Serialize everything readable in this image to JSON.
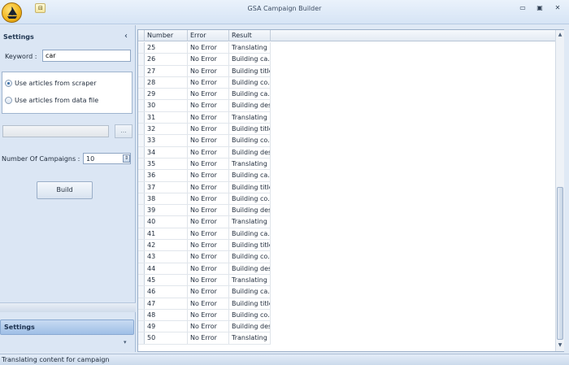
{
  "window": {
    "title": "GSA Campaign Builder",
    "qat_glyph": "⊟",
    "minimize_glyph": "▭",
    "maximize_glyph": "▣",
    "close_glyph": "✕"
  },
  "settings": {
    "title": "Settings",
    "collapse_glyph": "‹",
    "keyword_label": "Keyword :",
    "keyword_value": "car",
    "radio_scraper_label": "Use articles from scraper",
    "radio_file_label": "Use articles from data file",
    "selected_source": "scraper",
    "browse_label": "...",
    "campaigns_label": "Number Of Campaigns :",
    "campaigns_value": "10",
    "build_label": "Build",
    "tab_label": "Settings",
    "chevron_glyph": "▾"
  },
  "grid": {
    "columns": [
      "Number",
      "Error",
      "Result"
    ],
    "rows": [
      [
        "25",
        "No Error",
        "Translating ..."
      ],
      [
        "26",
        "No Error",
        "Building ca..."
      ],
      [
        "27",
        "No Error",
        "Building title..."
      ],
      [
        "28",
        "No Error",
        "Building co..."
      ],
      [
        "29",
        "No Error",
        "Building ca..."
      ],
      [
        "30",
        "No Error",
        "Building des..."
      ],
      [
        "31",
        "No Error",
        "Translating ..."
      ],
      [
        "32",
        "No Error",
        "Building title..."
      ],
      [
        "33",
        "No Error",
        "Building co..."
      ],
      [
        "34",
        "No Error",
        "Building des..."
      ],
      [
        "35",
        "No Error",
        "Translating ..."
      ],
      [
        "36",
        "No Error",
        "Building ca..."
      ],
      [
        "37",
        "No Error",
        "Building title..."
      ],
      [
        "38",
        "No Error",
        "Building co..."
      ],
      [
        "39",
        "No Error",
        "Building des..."
      ],
      [
        "40",
        "No Error",
        "Translating ..."
      ],
      [
        "41",
        "No Error",
        "Building ca..."
      ],
      [
        "42",
        "No Error",
        "Building title..."
      ],
      [
        "43",
        "No Error",
        "Building co..."
      ],
      [
        "44",
        "No Error",
        "Building des..."
      ],
      [
        "45",
        "No Error",
        "Translating ..."
      ],
      [
        "46",
        "No Error",
        "Building ca..."
      ],
      [
        "47",
        "No Error",
        "Building title..."
      ],
      [
        "48",
        "No Error",
        "Building co..."
      ],
      [
        "49",
        "No Error",
        "Building des..."
      ],
      [
        "50",
        "No Error",
        "Translating ..."
      ]
    ],
    "scroll_up_glyph": "▲",
    "scroll_down_glyph": "▼"
  },
  "status": {
    "text": "Translating content for campaign"
  },
  "colors": {
    "accent": "#3a6ea5",
    "panel": "#dbe6f4",
    "tab_active": "#9fbfe6"
  },
  "icons": {
    "app": "ship-logo-icon",
    "qat": "quick-access-icon"
  }
}
